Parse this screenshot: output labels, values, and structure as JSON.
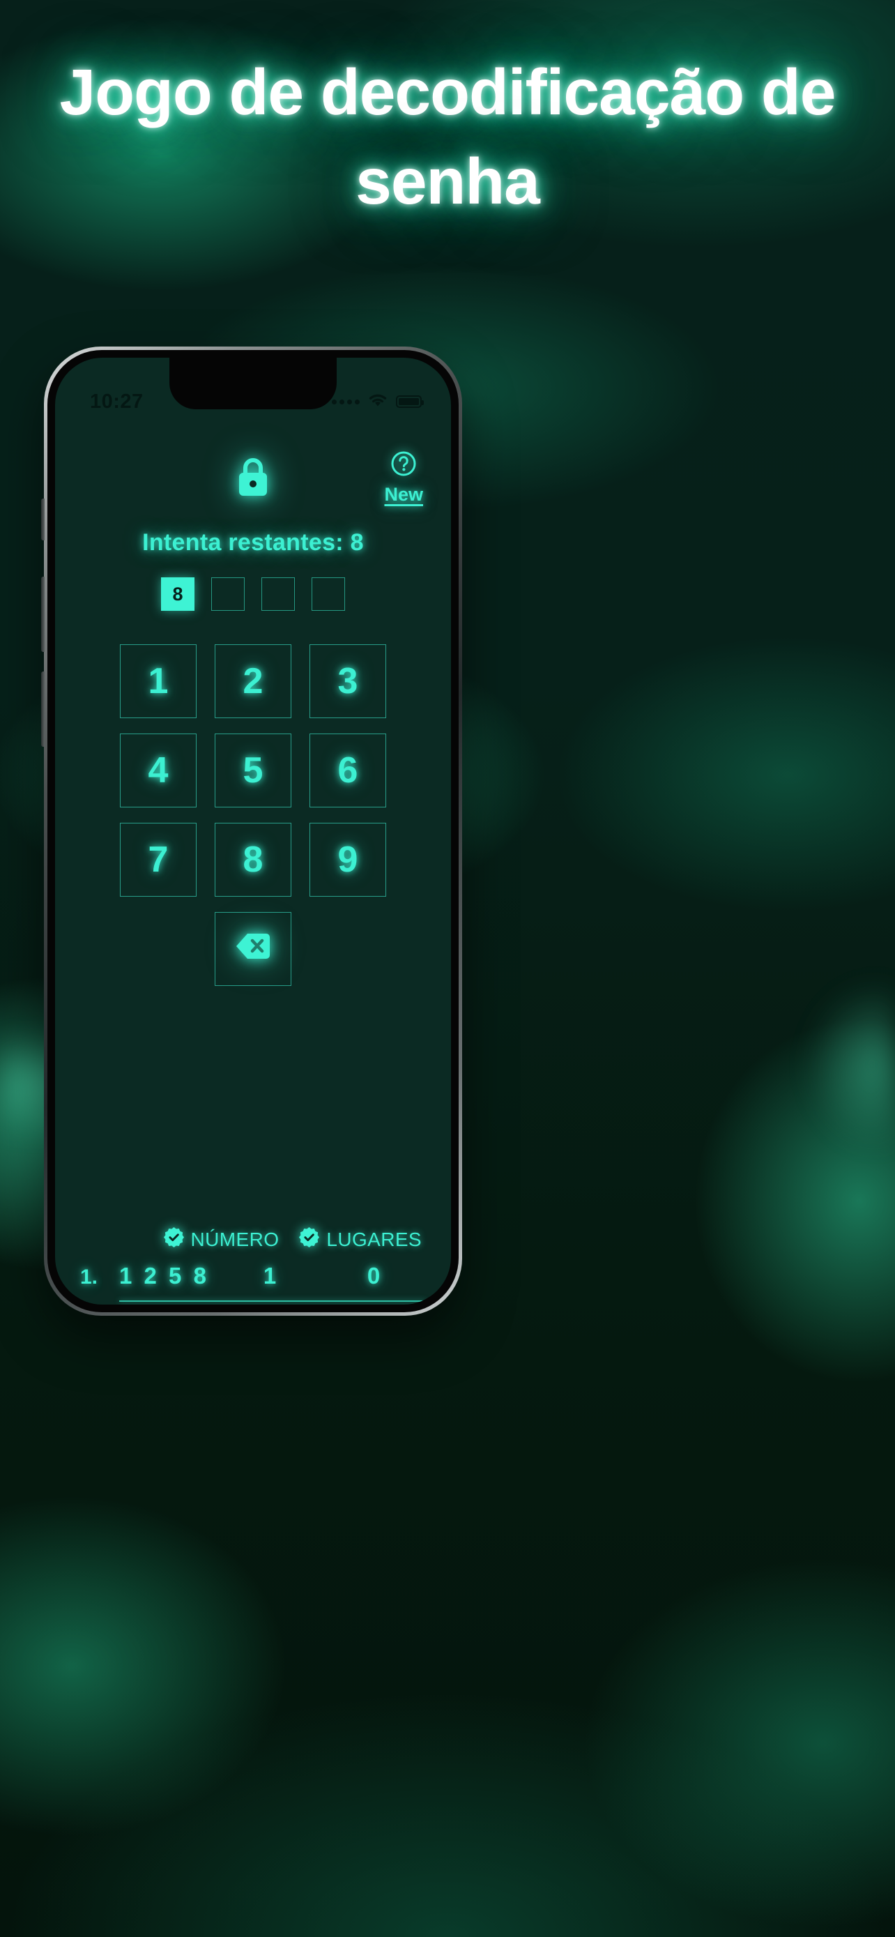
{
  "headline": "Jogo de decodificação de senha",
  "colors": {
    "accent": "#3cf0d2",
    "accent_fill": "#3ef3d4",
    "screen_bg": "#0b2a23",
    "headline_text": "#ffffff"
  },
  "phone": {
    "status_bar": {
      "time": "10:27",
      "signal_icon": "cellular-signal-icon",
      "wifi_icon": "wifi-icon",
      "battery_icon": "battery-icon"
    }
  },
  "app": {
    "lock_icon": "lock-icon",
    "help_icon": "help-circle-icon",
    "new_label": "New",
    "attempts_label": "Intenta restantes: 8",
    "slots": [
      {
        "value": "8",
        "filled": true
      },
      {
        "value": "",
        "filled": false
      },
      {
        "value": "",
        "filled": false
      },
      {
        "value": "",
        "filled": false
      }
    ],
    "keypad": {
      "keys": [
        "1",
        "2",
        "3",
        "4",
        "5",
        "6",
        "7",
        "8",
        "9"
      ],
      "backspace_icon": "backspace-icon"
    },
    "results": {
      "headers": [
        {
          "label": "NÚMERO",
          "icon": "verified-check-badge-icon"
        },
        {
          "label": "LUGARES",
          "icon": "verified-check-badge-icon"
        }
      ],
      "rows": [
        {
          "index": "1.",
          "guess": "1 2 5 8",
          "numero": "1",
          "lugares": "0"
        }
      ]
    }
  }
}
